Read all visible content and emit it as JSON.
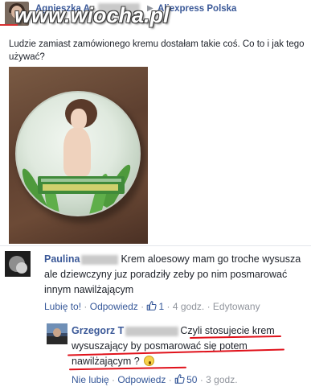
{
  "watermark": "www.wiocha.pl",
  "post": {
    "author": "Agnieszka A",
    "arrow": "▶",
    "group": "Aliexpress Polska",
    "text": "Ludzie zamiast zamówionego kremu dostałam takie coś. Co to i jak tego używać?"
  },
  "comment1": {
    "author": "Paulina",
    "text": "Krem aloesowy mam go troche wysusza ale dziewczyny juz poradziły zeby po nim posmarować innym nawilżającym",
    "actions": {
      "like": "Lubię to!",
      "reply": "Odpowiedz",
      "like_count": "1",
      "time": "4 godz.",
      "edited": "Edytowany"
    }
  },
  "comment2": {
    "author": "Grzegorz",
    "author_suffix": "T",
    "text": "Czyli stosujecie krem wysuszający by posmarować się potem nawilżającym ?",
    "actions": {
      "unlike": "Nie lubię",
      "reply": "Odpowiedz",
      "like_count": "50",
      "time": "3 godz."
    }
  },
  "colors": {
    "link": "#3b5998",
    "action": "#365899",
    "muted": "#90949c",
    "annotation": "#e0121b"
  }
}
